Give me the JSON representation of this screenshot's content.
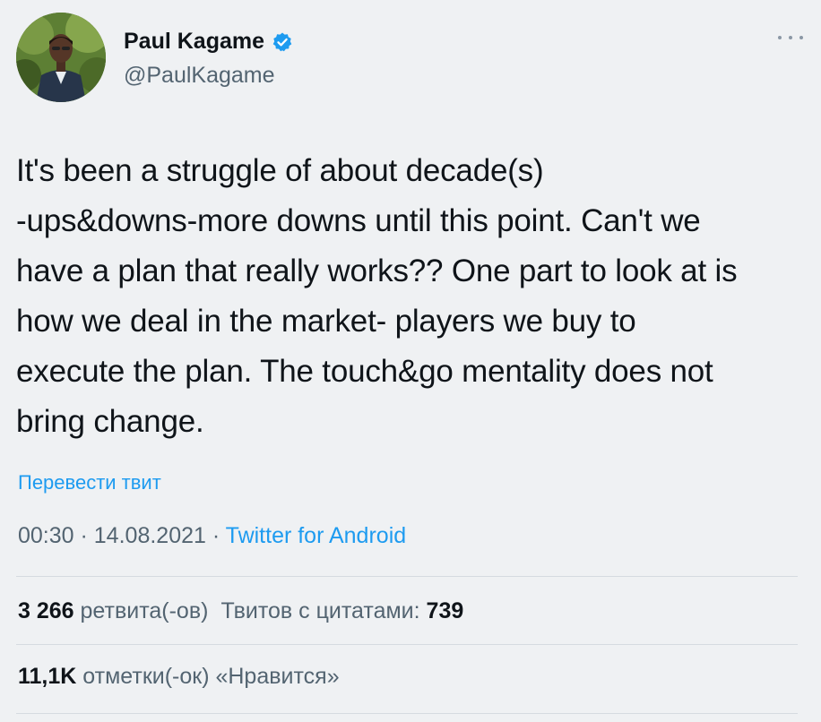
{
  "user": {
    "name": "Paul Kagame",
    "handle": "@PaulKagame",
    "verified_icon": "verified-badge-icon",
    "verified_color": "#1d9bf0"
  },
  "menu": {
    "more_icon": "more-horizontal-icon"
  },
  "tweet": {
    "lines": [
      "It's been a struggle of about decade(s)",
      "-ups&downs-more downs until this point. Can't we",
      "have a plan that really works?? One part to look at is",
      "how we deal in the market- players we buy to",
      "execute the plan. The touch&go mentality does not",
      "bring change."
    ]
  },
  "translate_label": "Перевести твит",
  "meta": {
    "time": "00:30",
    "separator": " · ",
    "date": "14.08.2021",
    "source": "Twitter for Android"
  },
  "stats": {
    "retweets_count": "3 266",
    "retweets_label": "ретвита(-ов)",
    "quotes_label": "Твитов с цитатами:",
    "quotes_count": "739",
    "likes_count": "11,1K",
    "likes_label": "отметки(-ок) «Нравится»"
  },
  "colors": {
    "background": "#eff1f3",
    "text": "#0f1419",
    "secondary": "#536471",
    "link": "#1d9bf0"
  }
}
